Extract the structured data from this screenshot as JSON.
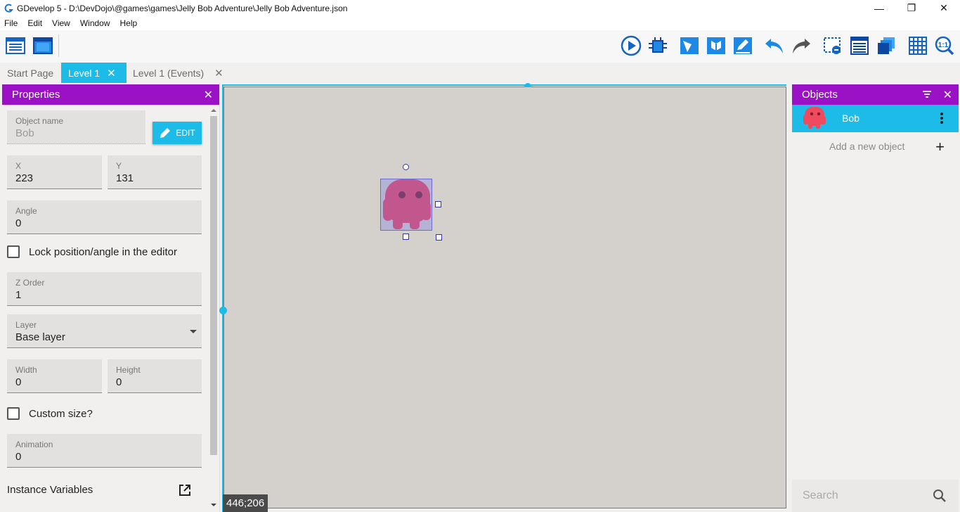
{
  "window": {
    "title": "GDevelop 5 - D:\\DevDojo\\@games\\games\\Jelly Bob Adventure\\Jelly Bob Adventure.json",
    "minimize": "—",
    "restore": "❐",
    "close": "✕"
  },
  "menu": [
    "File",
    "Edit",
    "View",
    "Window",
    "Help"
  ],
  "toolbar": {
    "left_icons": [
      "project-manager-icon",
      "scene-editor-icon"
    ],
    "right_icons": [
      "preview-play-icon",
      "debugger-icon",
      "open-objects-icon",
      "open-object-groups-icon",
      "edit-properties-icon",
      "undo-icon",
      "redo-icon",
      "instances-list-icon",
      "layers-icon",
      "layers-stack-icon",
      "grid-icon",
      "zoom-reset-icon"
    ]
  },
  "tabs": [
    {
      "label": "Start Page",
      "active": false,
      "closable": false
    },
    {
      "label": "Level 1",
      "active": true,
      "closable": true,
      "close": "✕"
    },
    {
      "label": "Level 1 (Events)",
      "active": false,
      "closable": true,
      "close": "✕"
    }
  ],
  "properties": {
    "title": "Properties",
    "close": "✕",
    "object_name_label": "Object name",
    "object_name_value": "Bob",
    "edit_label": "EDIT",
    "x_label": "X",
    "x_value": "223",
    "y_label": "Y",
    "y_value": "131",
    "angle_label": "Angle",
    "angle_value": "0",
    "lock_label": "Lock position/angle in the editor",
    "lock_checked": false,
    "zorder_label": "Z Order",
    "zorder_value": "1",
    "layer_label": "Layer",
    "layer_value": "Base layer",
    "width_label": "Width",
    "width_value": "0",
    "height_label": "Height",
    "height_value": "0",
    "custom_size_label": "Custom size?",
    "custom_size_checked": false,
    "animation_label": "Animation",
    "animation_value": "0",
    "instance_variables_label": "Instance Variables"
  },
  "canvas": {
    "cursor_coords": "446;206"
  },
  "objects": {
    "title": "Objects",
    "close": "✕",
    "items": [
      {
        "name": "Bob",
        "selected": true
      }
    ],
    "add_label": "Add a new object",
    "add_plus": "+",
    "search_placeholder": "Search"
  },
  "colors": {
    "accent": "#1dbce8",
    "panel_header": "#9b12c6",
    "scene_bg": "#d4d1cd",
    "bob": "#e8465e"
  }
}
